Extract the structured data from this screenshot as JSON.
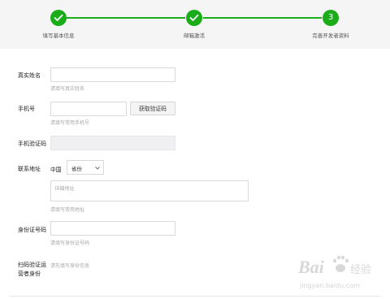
{
  "steps": [
    {
      "label": "填写基本信息",
      "status": "done"
    },
    {
      "label": "邮箱激活",
      "status": "done"
    },
    {
      "label": "完善开发者资料",
      "status": "current",
      "number": "3"
    }
  ],
  "form": {
    "real_name": {
      "label": "真实姓名",
      "hint": "请填写真实姓名",
      "value": ""
    },
    "phone": {
      "label": "手机号",
      "hint": "请填写常用手机号",
      "value": "",
      "button": "获取验证码"
    },
    "phone_code": {
      "label": "手机验证码",
      "value": ""
    },
    "address": {
      "label": "联系地址",
      "country": "中国",
      "province_select": "省份",
      "detail_placeholder": "详细地址",
      "hint": "请填写常用地址"
    },
    "id_number": {
      "label": "身份证号码",
      "hint": "请填写身份证号码",
      "value": ""
    },
    "scan_verify": {
      "label_line1": "扫码验证运",
      "label_line2": "营者身份",
      "hint": "请先填写身份信息"
    }
  },
  "watermark": {
    "text1": "Bai",
    "text2": "经验",
    "url": "jingyan.baidu.com"
  },
  "colors": {
    "accent": "#1aad19",
    "hint": "#a8a8a8",
    "step_bg": "#f5f5f6"
  }
}
